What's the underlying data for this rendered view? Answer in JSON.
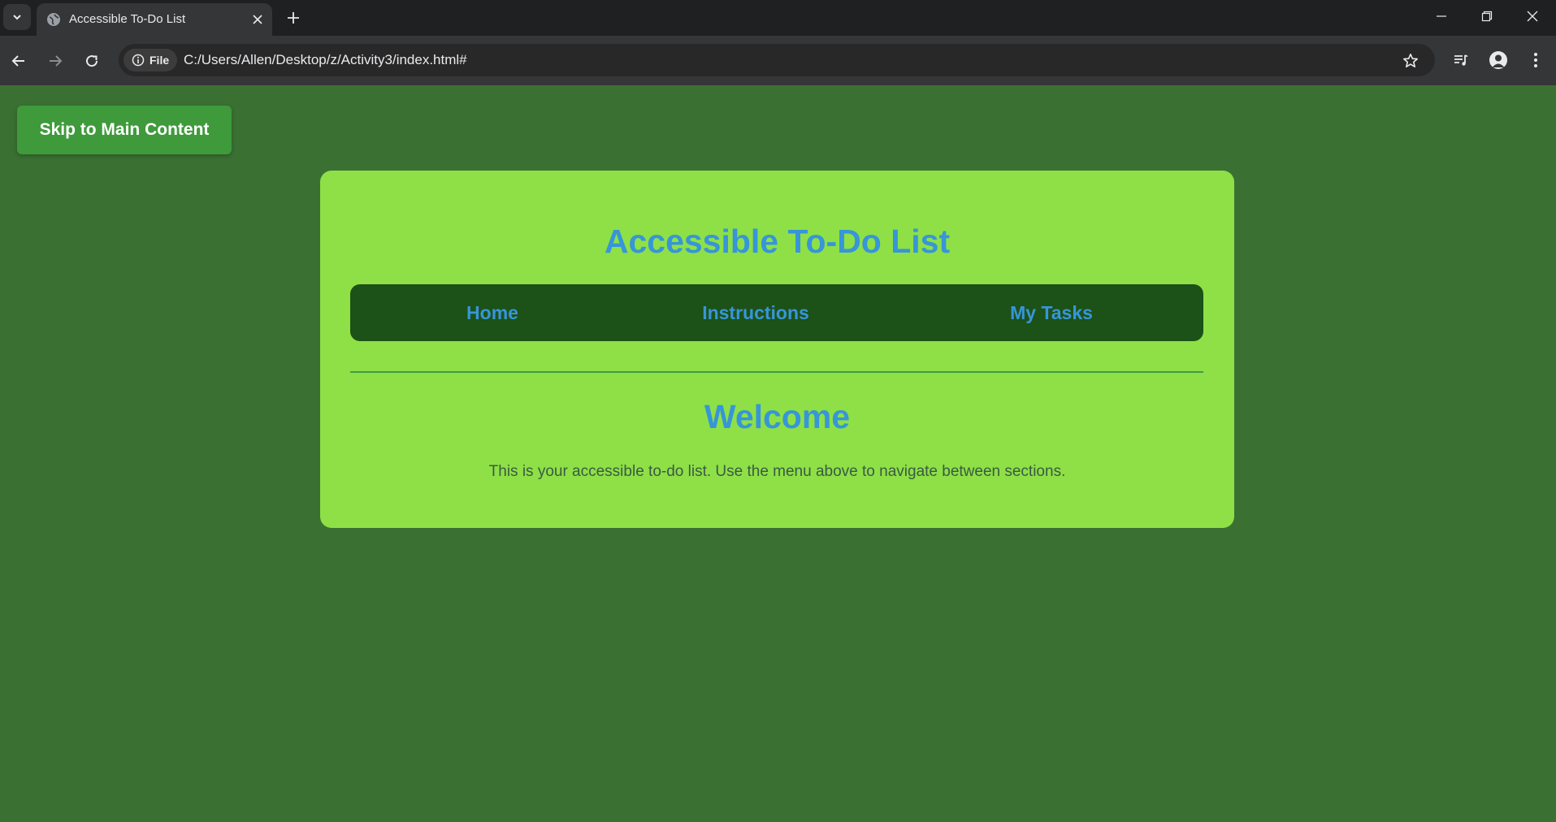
{
  "browser": {
    "tab_title": "Accessible To-Do List",
    "site_chip_label": "File",
    "url": "C:/Users/Allen/Desktop/z/Activity3/index.html#"
  },
  "page": {
    "skip_link": "Skip to Main Content",
    "title": "Accessible To-Do List",
    "nav": [
      "Home",
      "Instructions",
      "My Tasks"
    ],
    "section_heading": "Welcome",
    "section_text": "This is your accessible to-do list. Use the menu above to navigate between sections."
  },
  "colors": {
    "page_background": "#3a7133",
    "card_background": "#8ee046",
    "nav_background": "#1c5117",
    "accent_text": "#3795d9",
    "skip_button": "#3f9a3b",
    "divider": "#3e9c45"
  },
  "icons": [
    "tab-search-icon",
    "globe-icon",
    "close-icon",
    "plus-icon",
    "minimize-icon",
    "restore-icon",
    "back-icon",
    "forward-icon",
    "reload-icon",
    "info-icon",
    "star-icon",
    "media-control-icon",
    "profile-icon",
    "more-vert-icon"
  ]
}
